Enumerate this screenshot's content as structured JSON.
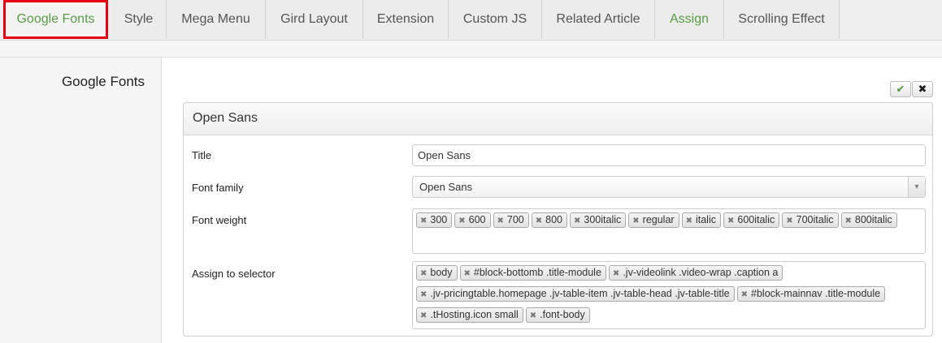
{
  "tabs": [
    {
      "label": "Google Fonts",
      "active": true,
      "color": "#5a9c46"
    },
    {
      "label": "Style"
    },
    {
      "label": "Mega Menu"
    },
    {
      "label": "Gird Layout"
    },
    {
      "label": "Extension"
    },
    {
      "label": "Custom JS"
    },
    {
      "label": "Related Article"
    },
    {
      "label": "Assign",
      "color": "#5a9c46"
    },
    {
      "label": "Scrolling Effect"
    }
  ],
  "section": {
    "label": "Google Fonts"
  },
  "actions": {
    "ok_icon": "check-icon",
    "cancel_icon": "close-icon"
  },
  "panel": {
    "title": "Open Sans",
    "title_field": {
      "label": "Title",
      "value": "Open Sans"
    },
    "font_family": {
      "label": "Font family",
      "value": "Open Sans"
    },
    "font_weight": {
      "label": "Font weight",
      "tags": [
        "300",
        "600",
        "700",
        "800",
        "300italic",
        "regular",
        "italic",
        "600italic",
        "700italic",
        "800italic"
      ]
    },
    "assign_selector": {
      "label": "Assign to selector",
      "tags": [
        "body",
        "#block-bottomb .title-module",
        ".jv-videolink .video-wrap .caption a",
        ".jv-pricingtable.homepage .jv-table-item .jv-table-head .jv-table-title",
        "#block-mainnav .title-module",
        ".tHosting.icon small",
        ".font-body"
      ]
    }
  },
  "colors": {
    "accent": "#5a9c46",
    "highlight": "#e3000f"
  }
}
